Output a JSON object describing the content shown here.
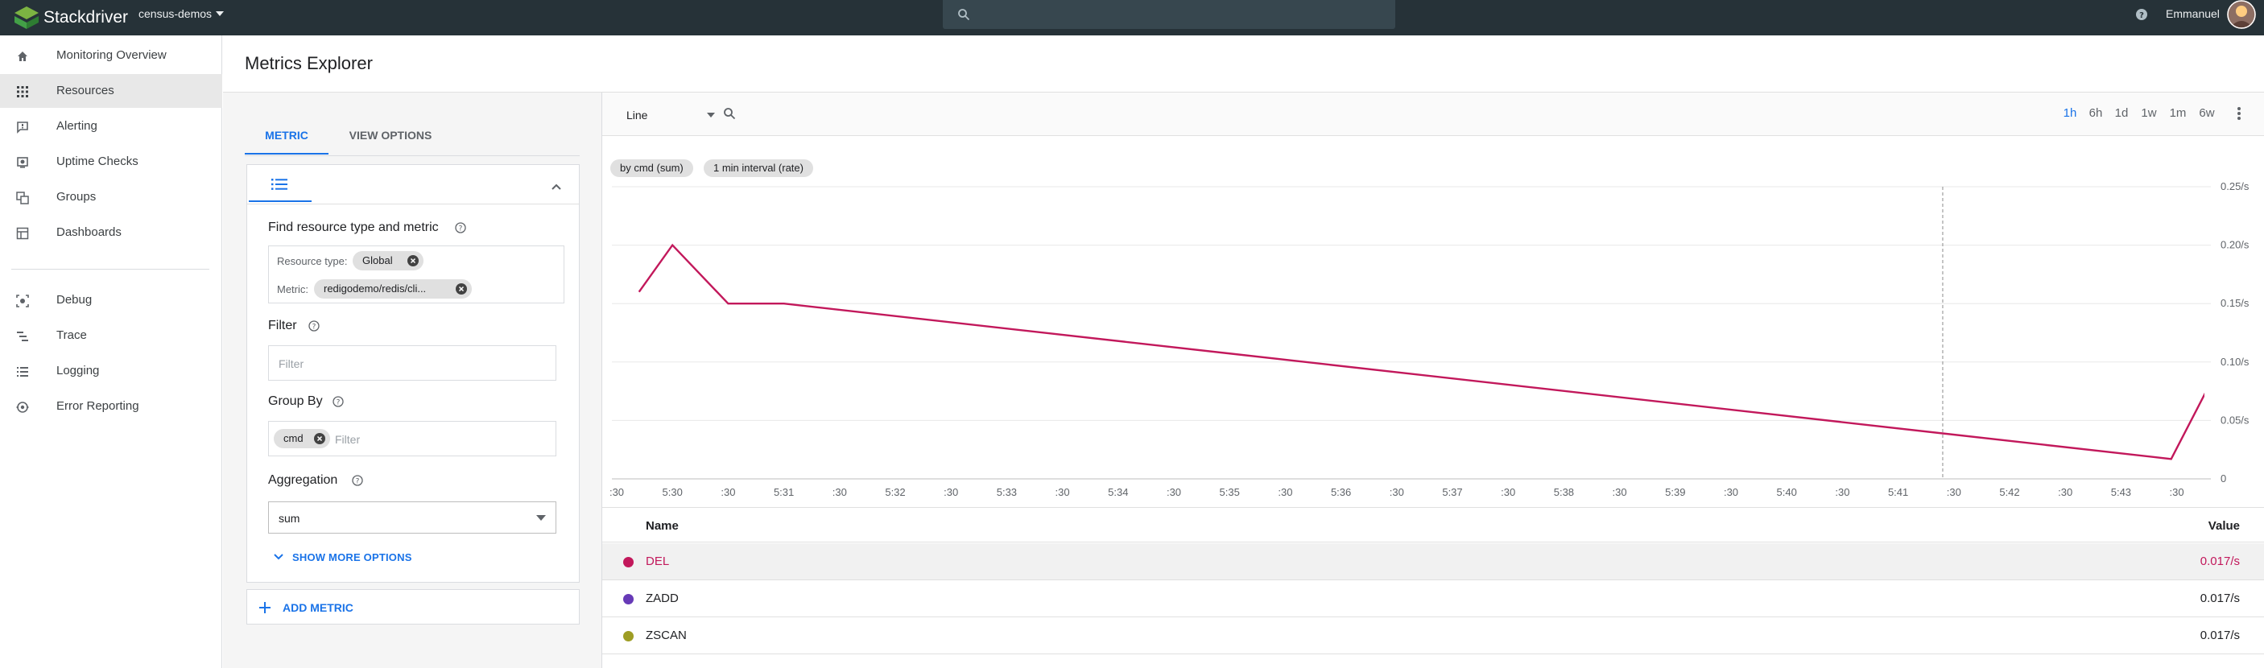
{
  "topbar": {
    "brand": "Stackdriver",
    "project": "census-demos",
    "search_placeholder": "",
    "username": "Emmanuel"
  },
  "sidebar": {
    "items": [
      {
        "label": "Monitoring Overview",
        "icon": "home-icon"
      },
      {
        "label": "Resources",
        "icon": "grid-icon",
        "active": true
      },
      {
        "label": "Alerting",
        "icon": "alert-chat-icon"
      },
      {
        "label": "Uptime Checks",
        "icon": "uptime-icon"
      },
      {
        "label": "Groups",
        "icon": "groups-icon"
      },
      {
        "label": "Dashboards",
        "icon": "dashboard-icon"
      },
      {
        "label": "Debug",
        "icon": "debug-icon"
      },
      {
        "label": "Trace",
        "icon": "trace-icon"
      },
      {
        "label": "Logging",
        "icon": "logging-icon"
      },
      {
        "label": "Error Reporting",
        "icon": "error-reporting-icon"
      }
    ]
  },
  "page": {
    "title": "Metrics Explorer"
  },
  "config": {
    "tabs": [
      "METRIC",
      "VIEW OPTIONS"
    ],
    "find_title": "Find resource type and metric",
    "resource_type_label": "Resource type:",
    "resource_type_value": "Global",
    "metric_label": "Metric:",
    "metric_value": "redigodemo/redis/cli...",
    "filter_title": "Filter",
    "filter_placeholder": "Filter",
    "group_by_title": "Group By",
    "group_by_chip": "cmd",
    "group_by_placeholder": "Filter",
    "aggregation_title": "Aggregation",
    "aggregation_value": "sum",
    "show_more": "SHOW MORE OPTIONS",
    "add_metric": "ADD METRIC"
  },
  "chart_toolbar": {
    "chart_type": "Line",
    "ranges": [
      "1h",
      "6h",
      "1d",
      "1w",
      "1m",
      "6w"
    ],
    "active_range": "1h"
  },
  "chart_data": {
    "type": "line",
    "chips": [
      "by cmd (sum)",
      "1 min interval (rate)"
    ],
    "x_ticks": [
      ":30",
      "5:30",
      ":30",
      "5:31",
      ":30",
      "5:32",
      ":30",
      "5:33",
      ":30",
      "5:34",
      ":30",
      "5:35",
      ":30",
      "5:36",
      ":30",
      "5:37",
      ":30",
      "5:38",
      ":30",
      "5:39",
      ":30",
      "5:40",
      ":30",
      "5:41",
      ":30",
      "5:42",
      ":30",
      "5:43",
      ":30"
    ],
    "y_ticks": [
      "0",
      "0.05/s",
      "0.10/s",
      "0.15/s",
      "0.20/s",
      "0.25/s"
    ],
    "ylim": [
      0,
      0.25
    ],
    "marker_x": 22.8,
    "series": [
      {
        "name": "DEL",
        "color": "#c2185b",
        "points": [
          [
            -0.6,
            0.16
          ],
          [
            0.0,
            0.2
          ],
          [
            1.0,
            0.15
          ],
          [
            2.0,
            0.15
          ],
          [
            26.9,
            0.017
          ],
          [
            27.8,
            0.1
          ]
        ]
      }
    ]
  },
  "legend_table": {
    "headers": {
      "name": "Name",
      "value": "Value"
    },
    "rows": [
      {
        "name": "DEL",
        "value": "0.017/s",
        "color": "#c2185b"
      },
      {
        "name": "ZADD",
        "value": "0.017/s",
        "color": "#673ab7"
      },
      {
        "name": "ZSCAN",
        "value": "0.017/s",
        "color": "#9e9d24"
      }
    ]
  }
}
